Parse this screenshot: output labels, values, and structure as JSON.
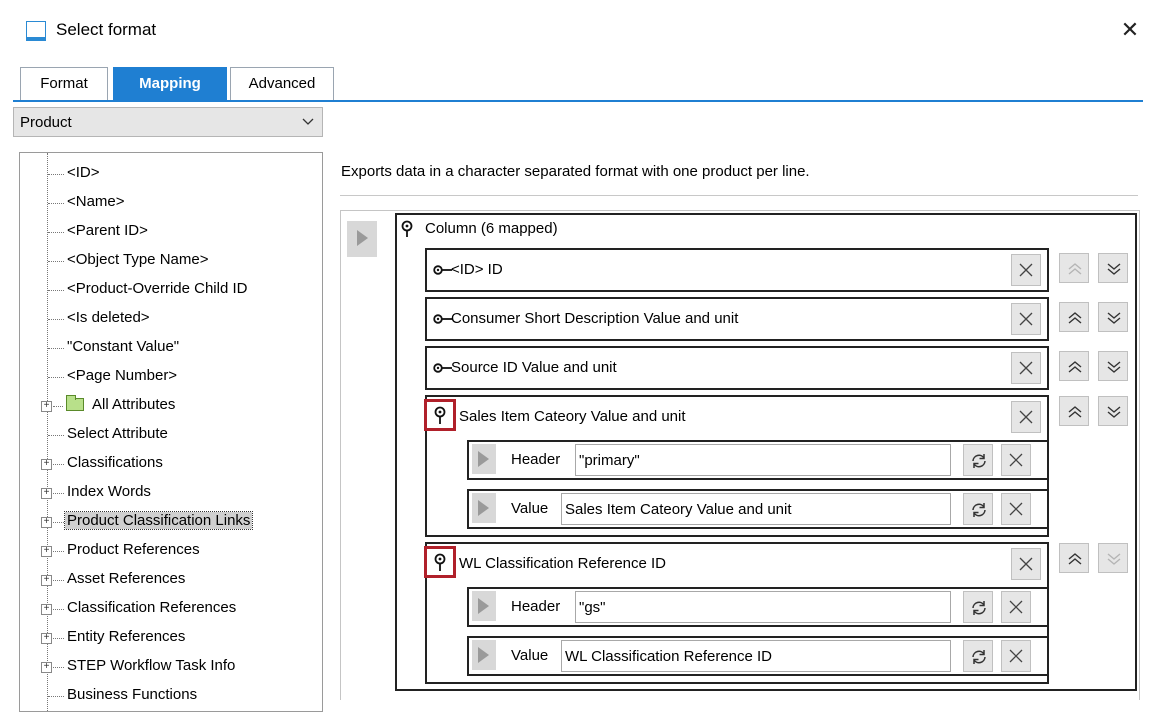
{
  "window": {
    "title": "Select format",
    "icons": {
      "app": "window-icon",
      "close": "close-icon"
    }
  },
  "tabs": [
    {
      "label": "Format",
      "active": false
    },
    {
      "label": "Mapping",
      "active": true
    },
    {
      "label": "Advanced",
      "active": false
    }
  ],
  "colors": {
    "accent": "#1f7fd2",
    "highlight_border": "#b0202a",
    "selected_item": "#d0d0d0"
  },
  "entity_select": {
    "value": "Product"
  },
  "tree": {
    "items": [
      {
        "label": "<ID>"
      },
      {
        "label": "<Name>"
      },
      {
        "label": "<Parent ID>"
      },
      {
        "label": "<Object Type Name>"
      },
      {
        "label": "<Product-Override Child ID"
      },
      {
        "label": "<Is deleted>"
      },
      {
        "label": "\"Constant Value\""
      },
      {
        "label": "<Page Number>"
      },
      {
        "label": "All Attributes",
        "expandable": true,
        "icon": "folder-icon"
      },
      {
        "label": "Select Attribute"
      },
      {
        "label": "Classifications",
        "expandable": true
      },
      {
        "label": "Index Words",
        "expandable": true
      },
      {
        "label": "Product Classification Links",
        "expandable": true,
        "selected": true
      },
      {
        "label": "Product References",
        "expandable": true
      },
      {
        "label": "Asset References",
        "expandable": true
      },
      {
        "label": "Classification References",
        "expandable": true
      },
      {
        "label": "Entity References",
        "expandable": true
      },
      {
        "label": "STEP Workflow Task Info",
        "expandable": true
      },
      {
        "label": "Business Functions"
      }
    ]
  },
  "description": "Exports data in a character separated format with one product per line.",
  "column": {
    "label": "Column (6 mapped)",
    "rows": [
      {
        "label": "<ID> ID",
        "up_enabled": false,
        "down_enabled": true
      },
      {
        "label": "Consumer Short Description Value and unit",
        "up_enabled": true,
        "down_enabled": true
      },
      {
        "label": "Source ID Value and unit",
        "up_enabled": true,
        "down_enabled": true
      },
      {
        "label": "Sales Item Cateory Value and unit",
        "up_enabled": true,
        "down_enabled": true,
        "pinned": true,
        "header": {
          "label": "Header",
          "value": "\"primary\""
        },
        "value": {
          "label": "Value",
          "value": "Sales Item Cateory Value and unit"
        }
      },
      {
        "label": "WL Classification Reference ID",
        "up_enabled": true,
        "down_enabled": false,
        "pinned": true,
        "header": {
          "label": "Header",
          "value": "\"gs\""
        },
        "value": {
          "label": "Value",
          "value": "WL Classification Reference ID"
        }
      }
    ]
  }
}
